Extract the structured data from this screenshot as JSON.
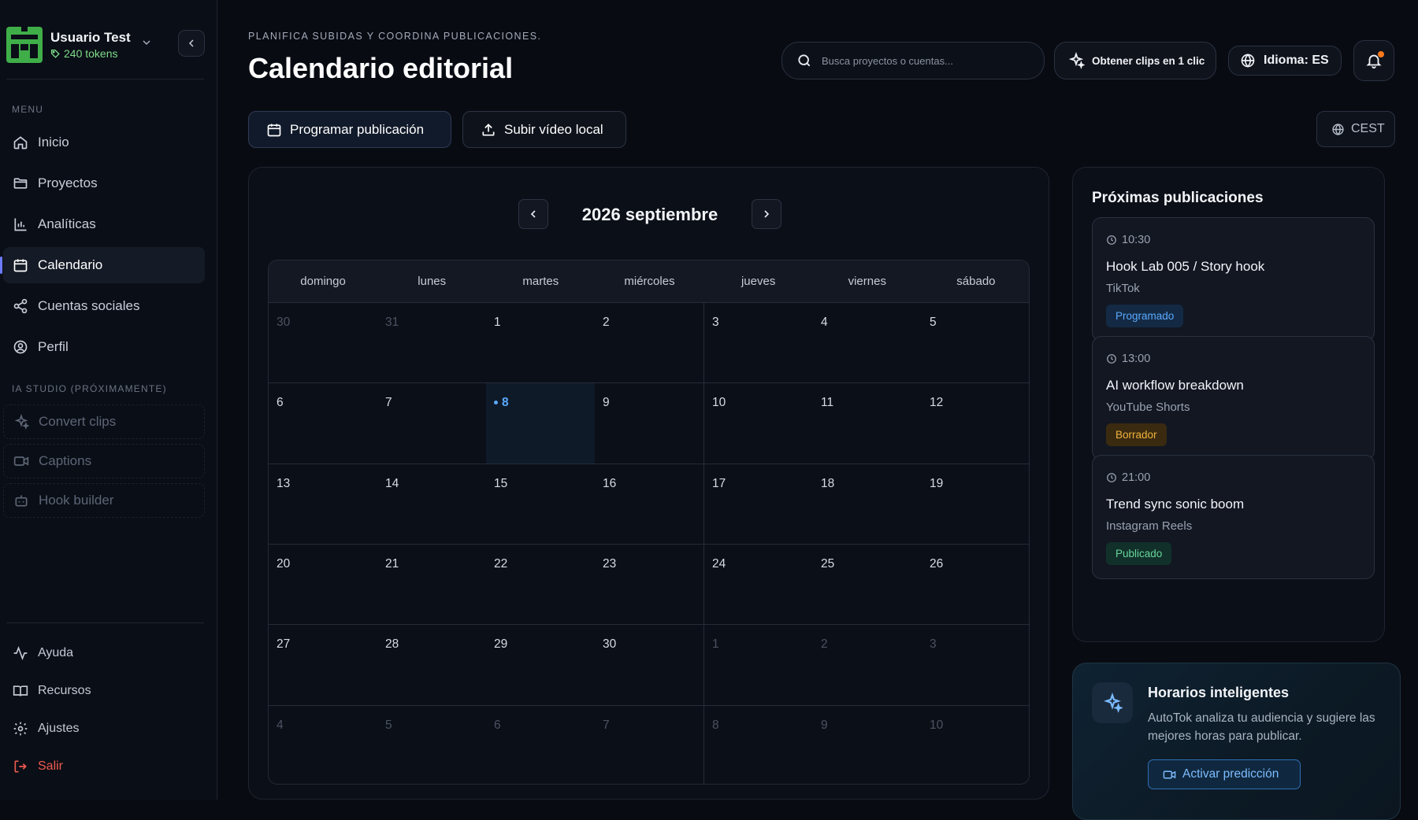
{
  "user": {
    "name": "Usuario Test",
    "tokens": "240 tokens"
  },
  "sidebar": {
    "menu_label": "MENU",
    "items": [
      {
        "label": "Inicio",
        "icon": "home-icon"
      },
      {
        "label": "Proyectos",
        "icon": "folder-icon"
      },
      {
        "label": "Analíticas",
        "icon": "bar-chart-icon"
      },
      {
        "label": "Calendario",
        "icon": "calendar-icon",
        "active": true
      },
      {
        "label": "Cuentas sociales",
        "icon": "share-icon"
      },
      {
        "label": "Perfil",
        "icon": "user-circle-icon"
      }
    ],
    "studio_label": "IA STUDIO (PRÓXIMAMENTE)",
    "studio_items": [
      {
        "label": "Convert clips",
        "icon": "sparkles-icon"
      },
      {
        "label": "Captions",
        "icon": "video-icon"
      },
      {
        "label": "Hook builder",
        "icon": "bot-icon"
      }
    ],
    "bottom_items": [
      {
        "label": "Ayuda",
        "icon": "activity-icon"
      },
      {
        "label": "Recursos",
        "icon": "book-icon"
      },
      {
        "label": "Ajustes",
        "icon": "gear-icon"
      },
      {
        "label": "Salir",
        "icon": "logout-icon"
      }
    ]
  },
  "header": {
    "eyebrow": "PLANIFICA SUBIDAS Y COORDINA PUBLICACIONES.",
    "title": "Calendario editorial",
    "search_placeholder": "Busca proyectos o cuentas...",
    "clips_button": "Obtener clips en 1 clic",
    "language_button": "Idioma: ES"
  },
  "actions": {
    "schedule": "Programar publicación",
    "upload": "Subir vídeo local",
    "timezone": "CEST"
  },
  "calendar": {
    "month_label": "2026 septiembre",
    "weekdays": [
      "domingo",
      "lunes",
      "martes",
      "miércoles",
      "jueves",
      "viernes",
      "sábado"
    ],
    "weeks": [
      [
        "30",
        "31",
        "1",
        "2",
        "3",
        "4",
        "5"
      ],
      [
        "6",
        "7",
        "8",
        "9",
        "10",
        "11",
        "12"
      ],
      [
        "13",
        "14",
        "15",
        "16",
        "17",
        "18",
        "19"
      ],
      [
        "20",
        "21",
        "22",
        "23",
        "24",
        "25",
        "26"
      ],
      [
        "27",
        "28",
        "29",
        "30",
        "1",
        "2",
        "3"
      ],
      [
        "4",
        "5",
        "6",
        "7",
        "8",
        "9",
        "10"
      ]
    ],
    "outside_days": [
      [
        0,
        0
      ],
      [
        0,
        1
      ],
      [
        4,
        4
      ],
      [
        4,
        5
      ],
      [
        4,
        6
      ],
      [
        5,
        0
      ],
      [
        5,
        1
      ],
      [
        5,
        2
      ],
      [
        5,
        3
      ],
      [
        5,
        4
      ],
      [
        5,
        5
      ],
      [
        5,
        6
      ]
    ],
    "today": [
      1,
      2
    ]
  },
  "upcoming": {
    "title": "Próximas publicaciones",
    "items": [
      {
        "time": "10:30",
        "title": "Hook Lab 005 / Story hook",
        "platform": "TikTok",
        "status": "Programado",
        "status_color": "#5aa9ff",
        "status_bg": "#142a44"
      },
      {
        "time": "13:00",
        "title": "AI workflow breakdown",
        "platform": "YouTube Shorts",
        "status": "Borrador",
        "status_color": "#f0b43c",
        "status_bg": "#3a2a10"
      },
      {
        "time": "21:00",
        "title": "Trend sync sonic boom",
        "platform": "Instagram Reels",
        "status": "Publicado",
        "status_color": "#66d69a",
        "status_bg": "#12302a"
      }
    ]
  },
  "smart_schedule": {
    "title": "Horarios inteligentes",
    "description": "AutoTok analiza tu audiencia y sugiere las mejores horas para publicar.",
    "button": "Activar predicción"
  },
  "colors": {
    "accent": "#6d7cff",
    "today": "#5aa9ff",
    "logout": "#ef5a4f",
    "brand": "#3fae49"
  }
}
